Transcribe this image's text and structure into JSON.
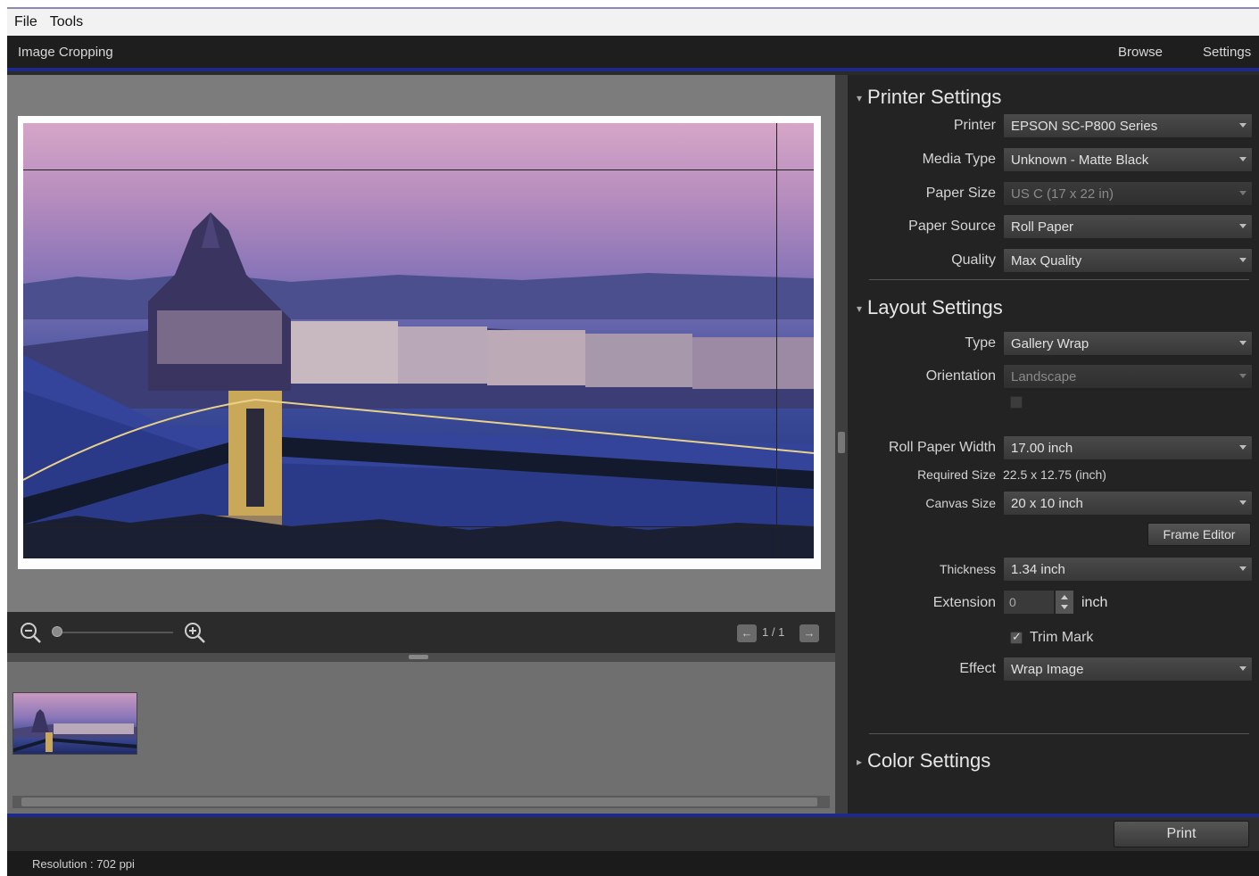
{
  "menubar": {
    "items": [
      "File",
      "Tools"
    ]
  },
  "header": {
    "title": "Image Cropping",
    "browse": "Browse",
    "settings": "Settings"
  },
  "preview": {
    "page_indicator": "1 / 1",
    "prev_glyph": "←",
    "next_glyph": "→"
  },
  "printer_settings": {
    "title": "Printer Settings",
    "printer_label": "Printer",
    "printer_value": "EPSON SC-P800 Series",
    "media_type_label": "Media Type",
    "media_type_value": "Unknown - Matte Black",
    "paper_size_label": "Paper Size",
    "paper_size_value": "US C (17 x 22 in)",
    "paper_source_label": "Paper Source",
    "paper_source_value": "Roll Paper",
    "quality_label": "Quality",
    "quality_value": "Max Quality"
  },
  "layout_settings": {
    "title": "Layout Settings",
    "type_label": "Type",
    "type_value": "Gallery Wrap",
    "orientation_label": "Orientation",
    "orientation_value": "Landscape",
    "roll_width_label": "Roll Paper Width",
    "roll_width_value": "17.00 inch",
    "required_size_label": "Required Size",
    "required_size_value": "22.5 x 12.75 (inch)",
    "canvas_size_label": "Canvas Size",
    "canvas_size_value": "20 x 10 inch",
    "frame_button": "Frame Editor",
    "thickness_label": "Thickness",
    "thickness_value": "1.34 inch",
    "extension_label": "Extension",
    "extension_value": "0",
    "extension_unit": "inch",
    "trim_mark_label": "Trim Mark",
    "effect_label": "Effect",
    "effect_value": "Wrap Image"
  },
  "color_settings": {
    "title": "Color Settings"
  },
  "footer": {
    "print_label": "Print"
  },
  "status": {
    "text": "Resolution : 702 ppi"
  },
  "colors": {
    "accent": "#1d2a8a",
    "panel": "#232323"
  },
  "icons": [
    "zoom-out-icon",
    "zoom-in-icon",
    "caret-icon",
    "dropdown-arrow-icon"
  ]
}
